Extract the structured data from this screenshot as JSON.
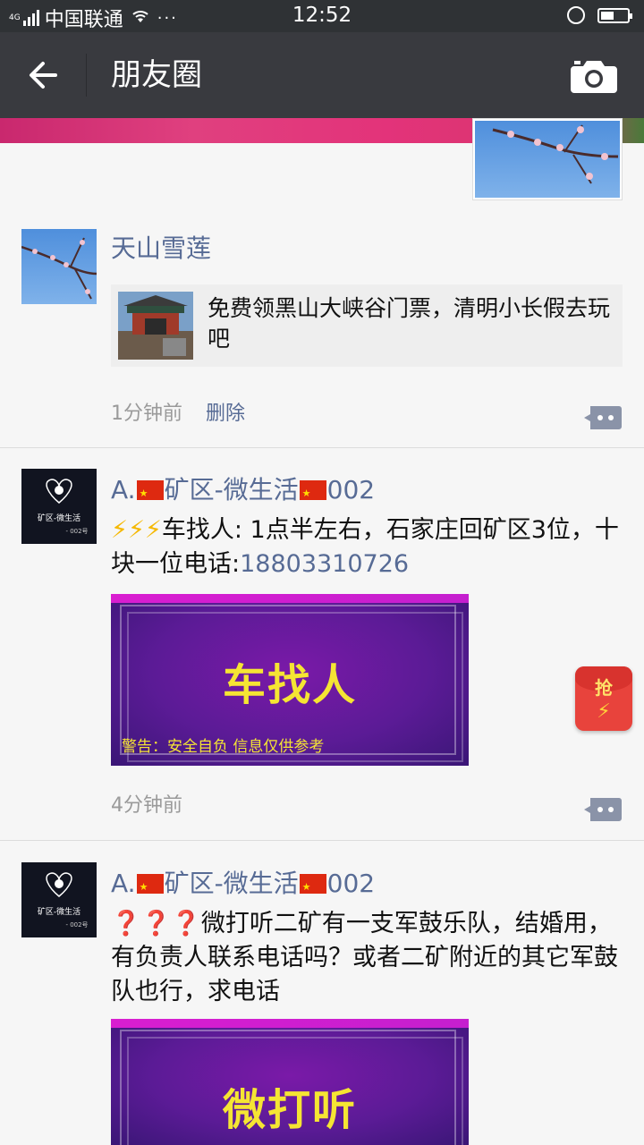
{
  "status_bar": {
    "network": "4G",
    "carrier": "中国联通",
    "dots": "···",
    "time": "12:52",
    "battery_level": 0.5
  },
  "nav": {
    "title": "朋友圈",
    "back_icon": "back-arrow-icon",
    "camera_icon": "camera-icon"
  },
  "posts": [
    {
      "name": "天山雪莲",
      "share_text": "免费领黑山大峡谷门票，清明小长假去玩吧",
      "time": "1分钟前",
      "delete_label": "删除"
    },
    {
      "name_prefix": "A.",
      "name_mid": "矿区-微生活",
      "name_suffix": "002",
      "text_emoji": "⚡⚡⚡",
      "text_body": "车找人: 1点半左右，石家庄回矿区3位，十块一位电话:",
      "phone": "18803310726",
      "banner_title": "车找人",
      "banner_warning": "警告：安全自负 信息仅供参考",
      "time": "4分钟前",
      "avatar_text": "矿区-微生活",
      "avatar_sub": "- 002号"
    },
    {
      "name_prefix": "A.",
      "name_mid": "矿区-微生活",
      "name_suffix": "002",
      "text_emoji": "❓❓❓",
      "text_body": "微打听二矿有一支军鼓乐队，结婚用，有负责人联系电话吗？或者二矿附近的其它军鼓队也行，求电话",
      "banner_title": "微打听",
      "avatar_text": "矿区-微生活",
      "avatar_sub": "- 002号"
    }
  ],
  "red_packet": {
    "label": "抢"
  }
}
